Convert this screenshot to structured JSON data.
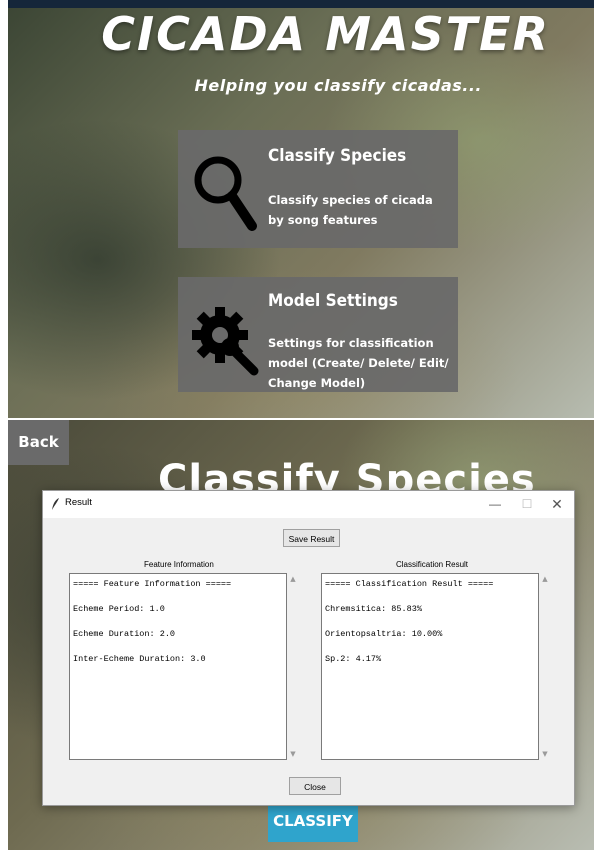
{
  "home": {
    "title": "CICADA MASTER",
    "subtitle": "Helping you classify cicadas...",
    "cards": [
      {
        "title": "Classify Species",
        "description": "Classify species of cicada by song features",
        "icon": "magnifier-icon"
      },
      {
        "title": "Model Settings",
        "description": "Settings for classification model (Create/ Delete/ Edit/ Change Model)",
        "icon": "gear-wrench-icon"
      }
    ]
  },
  "classify_screen": {
    "back_label": "Back",
    "title": "Classify Species",
    "classify_label": "CLASSIFY"
  },
  "result_dialog": {
    "window_title": "Result",
    "save_label": "Save Result",
    "close_label": "Close",
    "feature_label": "Feature Information",
    "classification_label": "Classification Result",
    "feature_lines": [
      "===== Feature Information =====",
      "Echeme Period: 1.0",
      "Echeme Duration: 2.0",
      "Inter-Echeme Duration: 3.0"
    ],
    "result_lines": [
      "===== Classification Result =====",
      "Chremsitica: 85.83%",
      "Orientopsaltria: 10.00%",
      "Sp.2: 4.17%"
    ]
  }
}
